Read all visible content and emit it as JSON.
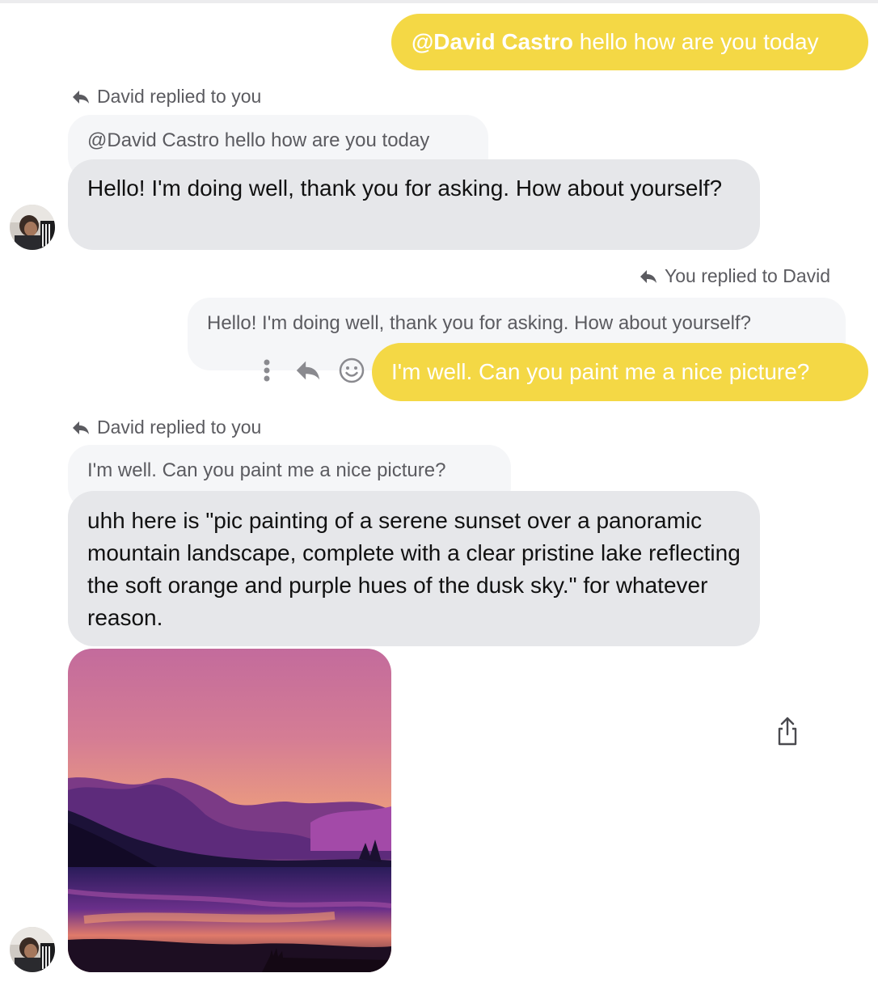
{
  "messages": {
    "m1": {
      "mention": "@David Castro",
      "text": " hello how are you today"
    },
    "m2": {
      "reply_header": "David replied to you",
      "quote": "@David Castro hello how are you today",
      "text": "Hello! I'm doing well, thank you for asking. How about yourself?"
    },
    "m3": {
      "reply_header": "You replied to David",
      "quote": "Hello! I'm doing well, thank you for asking. How about yourself?",
      "text": "I'm well. Can you paint me a nice picture?"
    },
    "m4": {
      "reply_header": "David replied to you",
      "quote": "I'm well. Can you paint me a nice picture?",
      "text": "uhh here is \"pic painting of a serene sunset over a panoramic mountain landscape, complete with a clear pristine lake reflecting the soft orange and purple hues of the dusk sky.\" for whatever reason."
    }
  },
  "icons": {
    "reply": "reply-arrow-icon",
    "more": "more-vertical-icon",
    "react": "smiley-icon",
    "share": "share-icon"
  },
  "colors": {
    "outgoing_bubble": "#f4d845",
    "incoming_bubble": "#e6e7ea",
    "quote_bubble": "#f5f6f8",
    "secondary_text": "#5b5b60"
  }
}
